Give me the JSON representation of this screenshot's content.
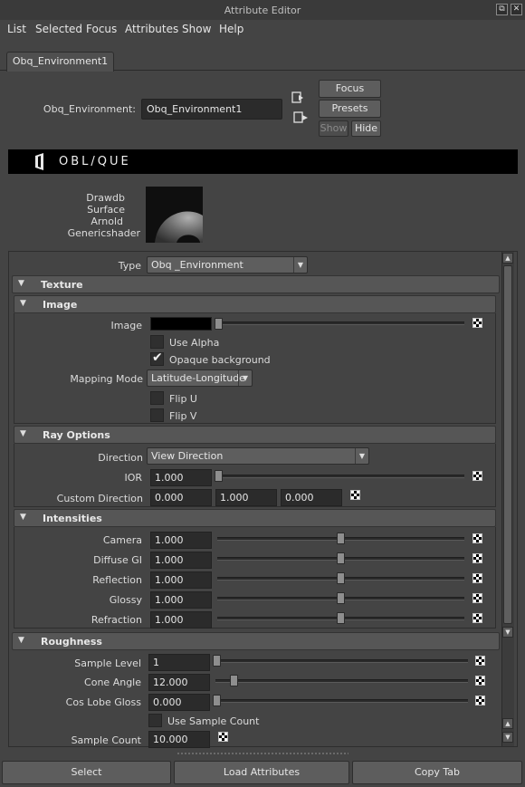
{
  "window": {
    "title": "Attribute Editor",
    "btn_float": "⧉",
    "btn_close": "✕"
  },
  "menubar": [
    "List",
    "Selected",
    "Focus",
    "Attributes",
    "Show",
    "Help"
  ],
  "tab": {
    "label": "Obq_Environment1"
  },
  "node": {
    "label": "Obq_Environment:",
    "value": "Obq_Environment1",
    "buttons": {
      "focus": "Focus",
      "presets": "Presets",
      "show": "Show",
      "hide": "Hide"
    }
  },
  "logo": {
    "text": "OBL/QUE"
  },
  "classification": [
    "Drawdb",
    "Surface",
    "Arnold",
    "Genericshader"
  ],
  "type_row": {
    "label": "Type",
    "value": "Obq _Environment"
  },
  "sections": {
    "texture": "Texture",
    "image": "Image",
    "ray_options": "Ray Options",
    "intensities": "Intensities",
    "roughness": "Roughness"
  },
  "image": {
    "label": "Image",
    "color": "#000000",
    "use_alpha": {
      "label": "Use Alpha",
      "checked": false
    },
    "opaque_background": {
      "label": "Opaque background",
      "checked": true
    },
    "mapping_mode": {
      "label": "Mapping Mode",
      "value": "Latitude-Longitude"
    },
    "flip_u": {
      "label": "Flip U",
      "checked": false
    },
    "flip_v": {
      "label": "Flip V",
      "checked": false
    }
  },
  "ray_options": {
    "direction": {
      "label": "Direction",
      "value": "View Direction"
    },
    "ior": {
      "label": "IOR",
      "value": "1.000",
      "slider": 0.0
    },
    "custom_direction": {
      "label": "Custom Direction",
      "values": [
        "0.000",
        "1.000",
        "0.000"
      ]
    }
  },
  "intensities": [
    {
      "label": "Camera",
      "value": "1.000",
      "slider": 0.5
    },
    {
      "label": "Diffuse GI",
      "value": "1.000",
      "slider": 0.5
    },
    {
      "label": "Reflection",
      "value": "1.000",
      "slider": 0.5
    },
    {
      "label": "Glossy",
      "value": "1.000",
      "slider": 0.5
    },
    {
      "label": "Refraction",
      "value": "1.000",
      "slider": 0.5
    }
  ],
  "roughness": {
    "sample_level": {
      "label": "Sample Level",
      "value": "1",
      "slider": 0.0
    },
    "cone_angle": {
      "label": "Cone Angle",
      "value": "12.000",
      "slider": 0.07
    },
    "cos_lobe_gloss": {
      "label": "Cos Lobe Gloss",
      "value": "0.000",
      "slider": 0.0
    },
    "use_sample_count": {
      "label": "Use Sample Count",
      "checked": false
    },
    "sample_count": {
      "label": "Sample Count",
      "value": "10.000"
    }
  },
  "bottom_buttons": {
    "select": "Select",
    "load": "Load Attributes",
    "copy": "Copy Tab"
  }
}
